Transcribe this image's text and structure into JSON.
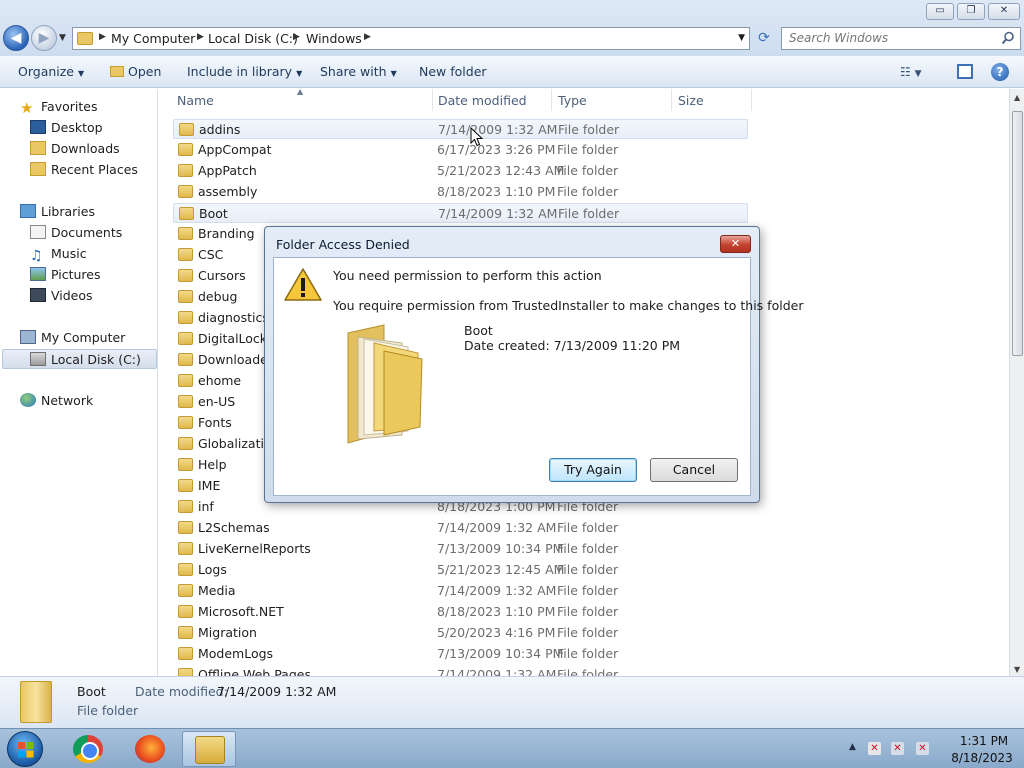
{
  "window": {
    "caption_buttons": {
      "minimize": "▭",
      "maximize": "❐",
      "close": "✕"
    }
  },
  "address_bar": {
    "breadcrumbs": [
      "My Computer",
      "Local Disk (C:)",
      "Windows"
    ],
    "separator": "▶",
    "search_placeholder": "Search Windows"
  },
  "toolbar": {
    "organize": "Organize",
    "open": "Open",
    "include_in_library": "Include in library",
    "share_with": "Share with",
    "new_folder": "New folder"
  },
  "nav_pane": {
    "favorites": "Favorites",
    "favorites_items": [
      "Desktop",
      "Downloads",
      "Recent Places"
    ],
    "libraries": "Libraries",
    "libraries_items": [
      "Documents",
      "Music",
      "Pictures",
      "Videos"
    ],
    "computer": "My Computer",
    "computer_items": [
      "Local Disk (C:)"
    ],
    "network": "Network"
  },
  "columns": {
    "name": "Name",
    "date_modified": "Date modified",
    "type": "Type",
    "size": "Size"
  },
  "files": [
    {
      "name": "addins",
      "date": "7/14/2009 1:32 AM",
      "type": "File folder"
    },
    {
      "name": "AppCompat",
      "date": "6/17/2023 3:26 PM",
      "type": "File folder"
    },
    {
      "name": "AppPatch",
      "date": "5/21/2023 12:43 AM",
      "type": "File folder"
    },
    {
      "name": "assembly",
      "date": "8/18/2023 1:10 PM",
      "type": "File folder"
    },
    {
      "name": "Boot",
      "date": "7/14/2009 1:32 AM",
      "type": "File folder"
    },
    {
      "name": "Branding",
      "date": "",
      "type": ""
    },
    {
      "name": "CSC",
      "date": "",
      "type": ""
    },
    {
      "name": "Cursors",
      "date": "",
      "type": ""
    },
    {
      "name": "debug",
      "date": "",
      "type": ""
    },
    {
      "name": "diagnostics",
      "date": "",
      "type": ""
    },
    {
      "name": "DigitalLocker",
      "date": "",
      "type": ""
    },
    {
      "name": "Downloaded",
      "date": "",
      "type": ""
    },
    {
      "name": "ehome",
      "date": "",
      "type": ""
    },
    {
      "name": "en-US",
      "date": "",
      "type": ""
    },
    {
      "name": "Fonts",
      "date": "",
      "type": ""
    },
    {
      "name": "Globalization",
      "date": "",
      "type": ""
    },
    {
      "name": "Help",
      "date": "",
      "type": ""
    },
    {
      "name": "IME",
      "date": "",
      "type": ""
    },
    {
      "name": "inf",
      "date": "8/18/2023 1:00 PM",
      "type": "File folder"
    },
    {
      "name": "L2Schemas",
      "date": "7/14/2009 1:32 AM",
      "type": "File folder"
    },
    {
      "name": "LiveKernelReports",
      "date": "7/13/2009 10:34 PM",
      "type": "File folder"
    },
    {
      "name": "Logs",
      "date": "5/21/2023 12:45 AM",
      "type": "File folder"
    },
    {
      "name": "Media",
      "date": "7/14/2009 1:32 AM",
      "type": "File folder"
    },
    {
      "name": "Microsoft.NET",
      "date": "8/18/2023 1:10 PM",
      "type": "File folder"
    },
    {
      "name": "Migration",
      "date": "5/20/2023 4:16 PM",
      "type": "File folder"
    },
    {
      "name": "ModemLogs",
      "date": "7/13/2009 10:34 PM",
      "type": "File folder"
    },
    {
      "name": "Offline Web Pages",
      "date": "7/14/2009 1:32 AM",
      "type": "File folder"
    }
  ],
  "details_pane": {
    "name": "Boot",
    "type": "File folder",
    "modified_label": "Date modified:",
    "modified_value": "7/14/2009 1:32 AM"
  },
  "dialog": {
    "title": "Folder Access Denied",
    "close": "✕",
    "heading": "You need permission to perform this action",
    "detail": "You require permission from TrustedInstaller to make changes to this folder",
    "item_name": "Boot",
    "item_created": "Date created: 7/13/2009 11:20 PM",
    "try_again": "Try Again",
    "cancel": "Cancel"
  },
  "taskbar": {
    "clock_time": "1:31 PM",
    "clock_date": "8/18/2023"
  },
  "colors": {
    "accent": "#3c7fb1",
    "selection": "#e6eef8",
    "close_red": "#c4422f"
  }
}
